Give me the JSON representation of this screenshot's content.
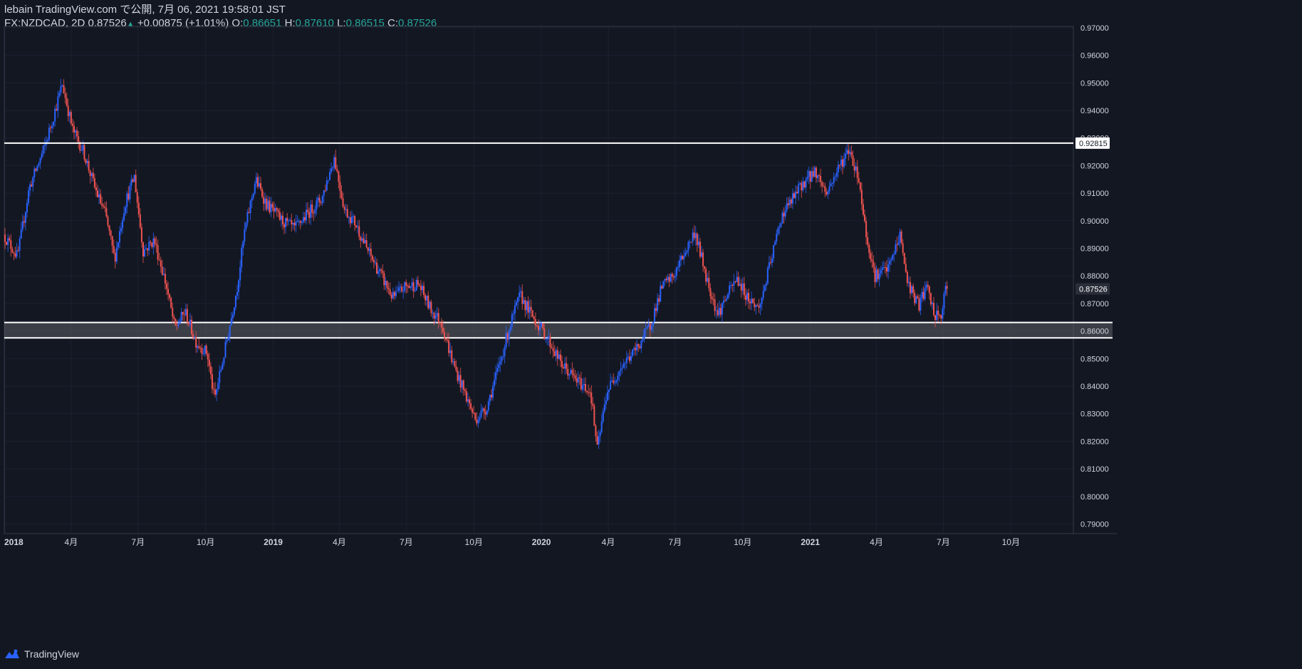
{
  "header": {
    "line1": "lebain TradingView.com で公開, 7月 06, 2021 19:58:01 JST",
    "symbol": "FX:NZDCAD, 2D",
    "last": "0.87526",
    "change": "+0.00875 (+1.01%)",
    "o_label": "O:",
    "o_value": "0.86651",
    "h_label": "H:",
    "h_value": "0.87610",
    "l_label": "L:",
    "l_value": "0.86515",
    "c_label": "C:",
    "c_value": "0.87526"
  },
  "footer": {
    "brand": "TradingView"
  },
  "colors": {
    "background": "#131722",
    "up": "#2962ff",
    "down": "#ef5350",
    "grid": "#1c2130",
    "axis_text": "#d1d4dc",
    "line": "#ffffff",
    "zone_fill": "#5d5f66"
  },
  "chart_data": {
    "type": "candlestick",
    "ylim": [
      0.7865,
      0.9705
    ],
    "y_ticks": [
      0.79,
      0.8,
      0.81,
      0.82,
      0.83,
      0.84,
      0.85,
      0.86,
      0.87,
      0.88,
      0.89,
      0.9,
      0.91,
      0.92,
      0.93,
      0.94,
      0.95,
      0.96,
      0.97
    ],
    "x_range": [
      "2017-12-31",
      "2021-12-25"
    ],
    "x_ticks": [
      {
        "date": "2018-01-01",
        "label": "2018",
        "bold": true
      },
      {
        "date": "2018-04-01",
        "label": "4月"
      },
      {
        "date": "2018-07-01",
        "label": "7月"
      },
      {
        "date": "2018-10-01",
        "label": "10月"
      },
      {
        "date": "2019-01-01",
        "label": "2019",
        "bold": true
      },
      {
        "date": "2019-04-01",
        "label": "4月"
      },
      {
        "date": "2019-07-01",
        "label": "7月"
      },
      {
        "date": "2019-10-01",
        "label": "10月"
      },
      {
        "date": "2020-01-01",
        "label": "2020",
        "bold": true
      },
      {
        "date": "2020-04-01",
        "label": "4月"
      },
      {
        "date": "2020-07-01",
        "label": "7月"
      },
      {
        "date": "2020-10-01",
        "label": "10月"
      },
      {
        "date": "2021-01-01",
        "label": "2021",
        "bold": true
      },
      {
        "date": "2021-04-01",
        "label": "4月"
      },
      {
        "date": "2021-07-01",
        "label": "7月"
      },
      {
        "date": "2021-10-01",
        "label": "10月"
      }
    ],
    "horizontal_line": {
      "price": 0.92815,
      "label": "0.92815"
    },
    "zone": {
      "top": 0.8631,
      "bottom": 0.8575
    },
    "last_price": {
      "price": 0.87526,
      "label": "0.87526"
    },
    "series": [
      {
        "name": "FX:NZDCAD, 2D",
        "path": [
          [
            "2018-01-01",
            0.895
          ],
          [
            "2018-01-20",
            0.887
          ],
          [
            "2018-02-05",
            0.912
          ],
          [
            "2018-02-25",
            0.926
          ],
          [
            "2018-03-10",
            0.938
          ],
          [
            "2018-03-22",
            0.9495
          ],
          [
            "2018-04-05",
            0.933
          ],
          [
            "2018-04-20",
            0.925
          ],
          [
            "2018-05-05",
            0.912
          ],
          [
            "2018-05-20",
            0.902
          ],
          [
            "2018-06-01",
            0.886
          ],
          [
            "2018-06-15",
            0.906
          ],
          [
            "2018-06-28",
            0.916
          ],
          [
            "2018-07-10",
            0.889
          ],
          [
            "2018-07-25",
            0.893
          ],
          [
            "2018-08-10",
            0.877
          ],
          [
            "2018-08-22",
            0.861
          ],
          [
            "2018-09-05",
            0.867
          ],
          [
            "2018-09-20",
            0.856
          ],
          [
            "2018-10-05",
            0.852
          ],
          [
            "2018-10-15",
            0.835
          ],
          [
            "2018-10-30",
            0.854
          ],
          [
            "2018-11-15",
            0.876
          ],
          [
            "2018-11-25",
            0.896
          ],
          [
            "2018-12-10",
            0.915
          ],
          [
            "2018-12-25",
            0.906
          ],
          [
            "2019-01-15",
            0.9
          ],
          [
            "2019-02-01",
            0.897
          ],
          [
            "2019-02-20",
            0.903
          ],
          [
            "2019-03-10",
            0.908
          ],
          [
            "2019-03-27",
            0.923
          ],
          [
            "2019-04-10",
            0.904
          ],
          [
            "2019-04-25",
            0.899
          ],
          [
            "2019-05-10",
            0.89
          ],
          [
            "2019-05-30",
            0.88
          ],
          [
            "2019-06-15",
            0.872
          ],
          [
            "2019-07-01",
            0.876
          ],
          [
            "2019-07-20",
            0.877
          ],
          [
            "2019-08-05",
            0.868
          ],
          [
            "2019-08-20",
            0.863
          ],
          [
            "2019-09-05",
            0.848
          ],
          [
            "2019-09-20",
            0.838
          ],
          [
            "2019-10-05",
            0.828
          ],
          [
            "2019-10-20",
            0.832
          ],
          [
            "2019-11-05",
            0.846
          ],
          [
            "2019-11-20",
            0.861
          ],
          [
            "2019-12-05",
            0.873
          ],
          [
            "2019-12-20",
            0.866
          ],
          [
            "2020-01-10",
            0.858
          ],
          [
            "2020-01-30",
            0.848
          ],
          [
            "2020-02-20",
            0.842
          ],
          [
            "2020-03-10",
            0.838
          ],
          [
            "2020-03-19",
            0.817
          ],
          [
            "2020-04-01",
            0.838
          ],
          [
            "2020-04-20",
            0.847
          ],
          [
            "2020-05-10",
            0.853
          ],
          [
            "2020-05-30",
            0.862
          ],
          [
            "2020-06-15",
            0.876
          ],
          [
            "2020-07-01",
            0.88
          ],
          [
            "2020-07-15",
            0.888
          ],
          [
            "2020-07-30",
            0.896
          ],
          [
            "2020-08-15",
            0.879
          ],
          [
            "2020-08-30",
            0.866
          ],
          [
            "2020-09-10",
            0.872
          ],
          [
            "2020-09-25",
            0.879
          ],
          [
            "2020-10-10",
            0.872
          ],
          [
            "2020-10-25",
            0.868
          ],
          [
            "2020-11-10",
            0.885
          ],
          [
            "2020-11-25",
            0.902
          ],
          [
            "2020-12-10",
            0.908
          ],
          [
            "2020-12-25",
            0.914
          ],
          [
            "2021-01-10",
            0.918
          ],
          [
            "2021-01-25",
            0.91
          ],
          [
            "2021-02-10",
            0.919
          ],
          [
            "2021-02-25",
            0.926
          ],
          [
            "2021-03-10",
            0.915
          ],
          [
            "2021-03-20",
            0.895
          ],
          [
            "2021-04-01",
            0.88
          ],
          [
            "2021-04-20",
            0.883
          ],
          [
            "2021-05-05",
            0.895
          ],
          [
            "2021-05-15",
            0.878
          ],
          [
            "2021-05-30",
            0.869
          ],
          [
            "2021-06-10",
            0.876
          ],
          [
            "2021-06-22",
            0.865
          ],
          [
            "2021-07-01",
            0.866
          ],
          [
            "2021-07-06",
            0.8753
          ]
        ]
      }
    ]
  }
}
